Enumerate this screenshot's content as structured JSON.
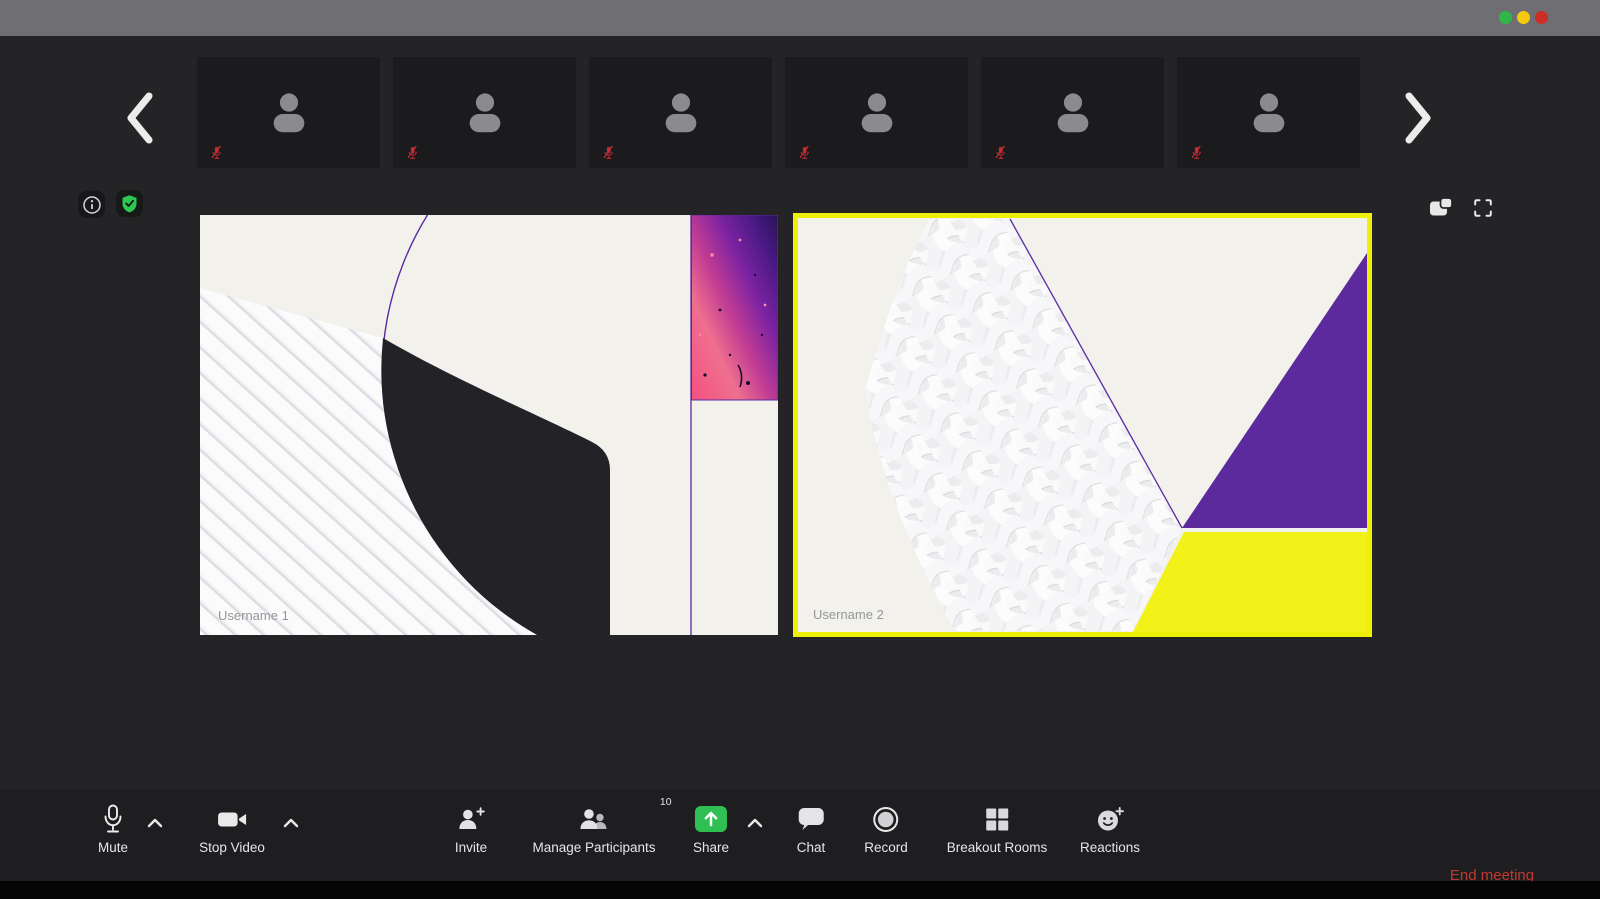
{
  "window": {
    "traffic_lights": [
      {
        "name": "green"
      },
      {
        "name": "yellow"
      },
      {
        "name": "red"
      }
    ]
  },
  "participants_strip": {
    "participants": [
      {
        "muted": true
      },
      {
        "muted": true
      },
      {
        "muted": true
      },
      {
        "muted": true
      },
      {
        "muted": true
      },
      {
        "muted": true
      }
    ]
  },
  "videos": [
    {
      "name": "Username 1",
      "active_speaker": false
    },
    {
      "name": "Username 2",
      "active_speaker": true
    }
  ],
  "toolbar": {
    "items": [
      {
        "id": "mute",
        "label": "Mute",
        "has_chevron": true
      },
      {
        "id": "stop-video",
        "label": "Stop Video",
        "has_chevron": true
      },
      {
        "id": "invite",
        "label": "Invite"
      },
      {
        "id": "manage-participants",
        "label": "Manage Participants",
        "badge": "10"
      },
      {
        "id": "share",
        "label": "Share",
        "has_chevron": true
      },
      {
        "id": "chat",
        "label": "Chat"
      },
      {
        "id": "record",
        "label": "Record"
      },
      {
        "id": "breakout-rooms",
        "label": "Breakout Rooms"
      },
      {
        "id": "reactions",
        "label": "Reactions"
      }
    ],
    "end_meeting_label": "End meeting"
  },
  "colors": {
    "titlebar_gray": "#6f6f73",
    "window_bg": "#242427",
    "toolbar_bg": "#1e1e21",
    "thumbnail_bg": "#1b1b1e",
    "share_green": "#2fbf52",
    "shield_green": "#2ec851",
    "muted_mic_red": "#c02b2f",
    "end_meeting_red": "#c0392f",
    "active_border_yellow": "#eef107",
    "art_purple": "#5c2a9c",
    "art_purple_line": "#5b2aa0",
    "art_pink": "#f4517f",
    "art_offwhite": "#f2f1ec",
    "art_black": "#232327"
  }
}
